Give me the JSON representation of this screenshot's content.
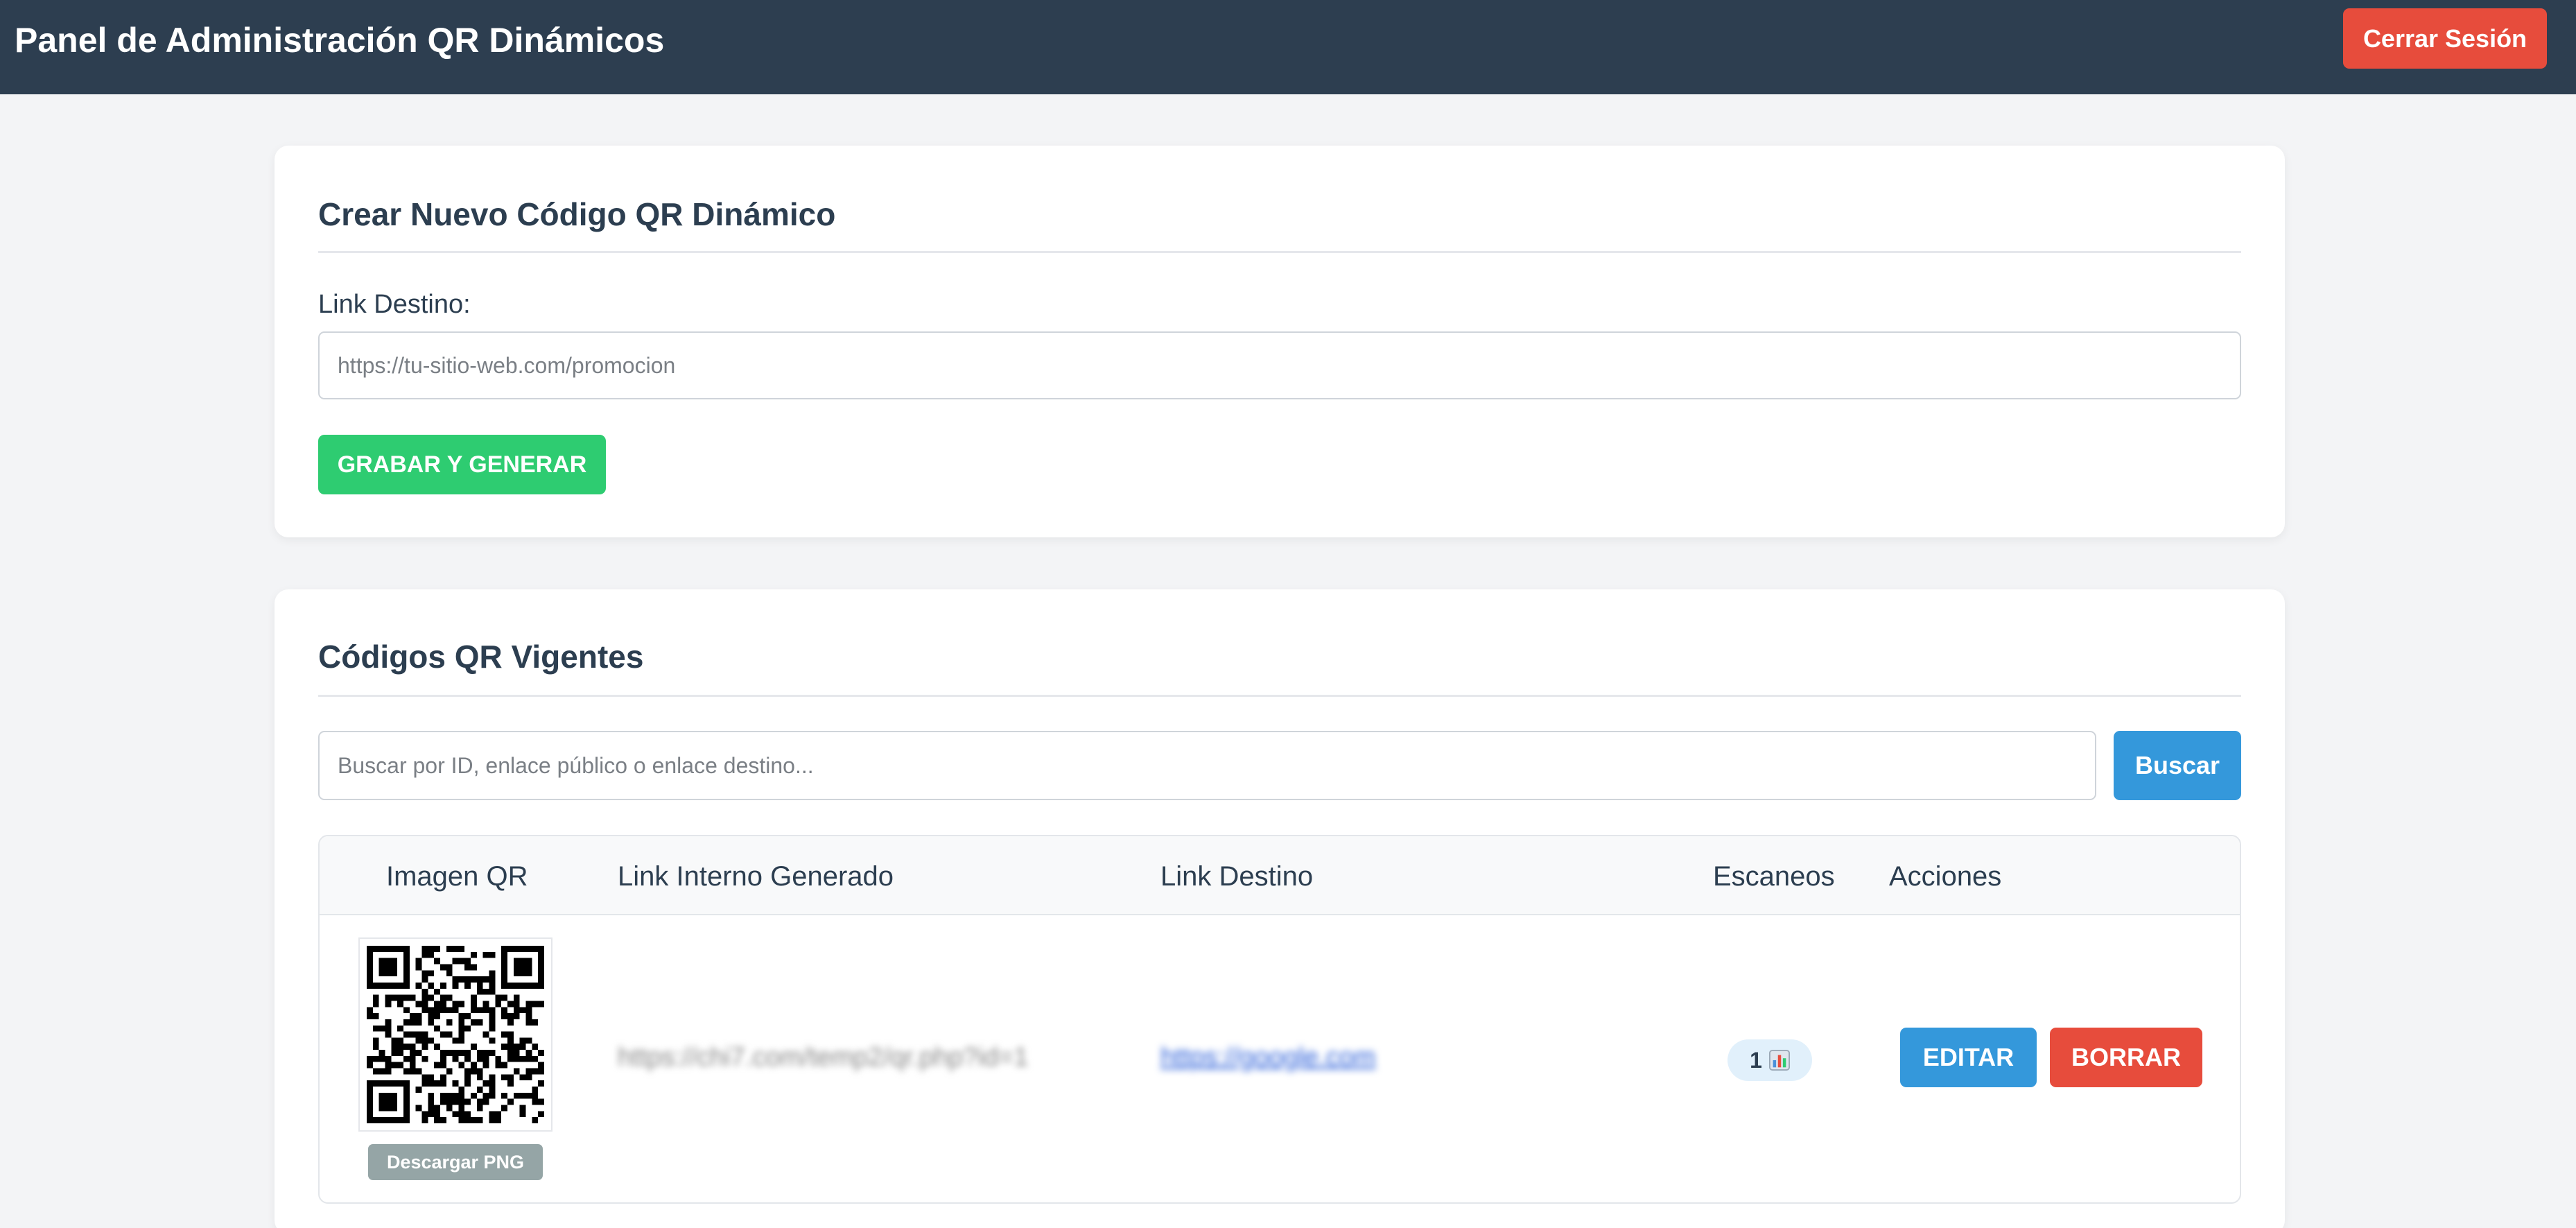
{
  "header": {
    "title": "Panel de Administración QR Dinámicos",
    "logout_label": "Cerrar Sesión"
  },
  "create_section": {
    "title": "Crear Nuevo Código QR Dinámico",
    "link_label": "Link Destino:",
    "link_placeholder": "https://tu-sitio-web.com/promocion",
    "link_value": "",
    "submit_label": "GRABAR Y GENERAR"
  },
  "list_section": {
    "title": "Códigos QR Vigentes",
    "search_placeholder": "Buscar por ID, enlace público o enlace destino...",
    "search_value": "",
    "search_button_label": "Buscar",
    "columns": [
      "Imagen QR",
      "Link Interno Generado",
      "Link Destino",
      "Escaneos",
      "Acciones"
    ],
    "rows": [
      {
        "qr_image_icon": "qr-code-image",
        "download_label": "Descargar PNG",
        "internal_link": "https://chi7.com/temp2/qr.php?id=1",
        "destination_link": "https://google.com",
        "scans": "1",
        "scans_icon": "bar-chart-icon",
        "edit_label": "EDITAR",
        "delete_label": "BORRAR"
      }
    ]
  },
  "colors": {
    "header_bg": "#2d3e50",
    "danger": "#e74c3c",
    "success": "#2ecc71",
    "primary": "#3498db",
    "muted": "#95a5a6",
    "page_bg": "#f3f4f6"
  }
}
